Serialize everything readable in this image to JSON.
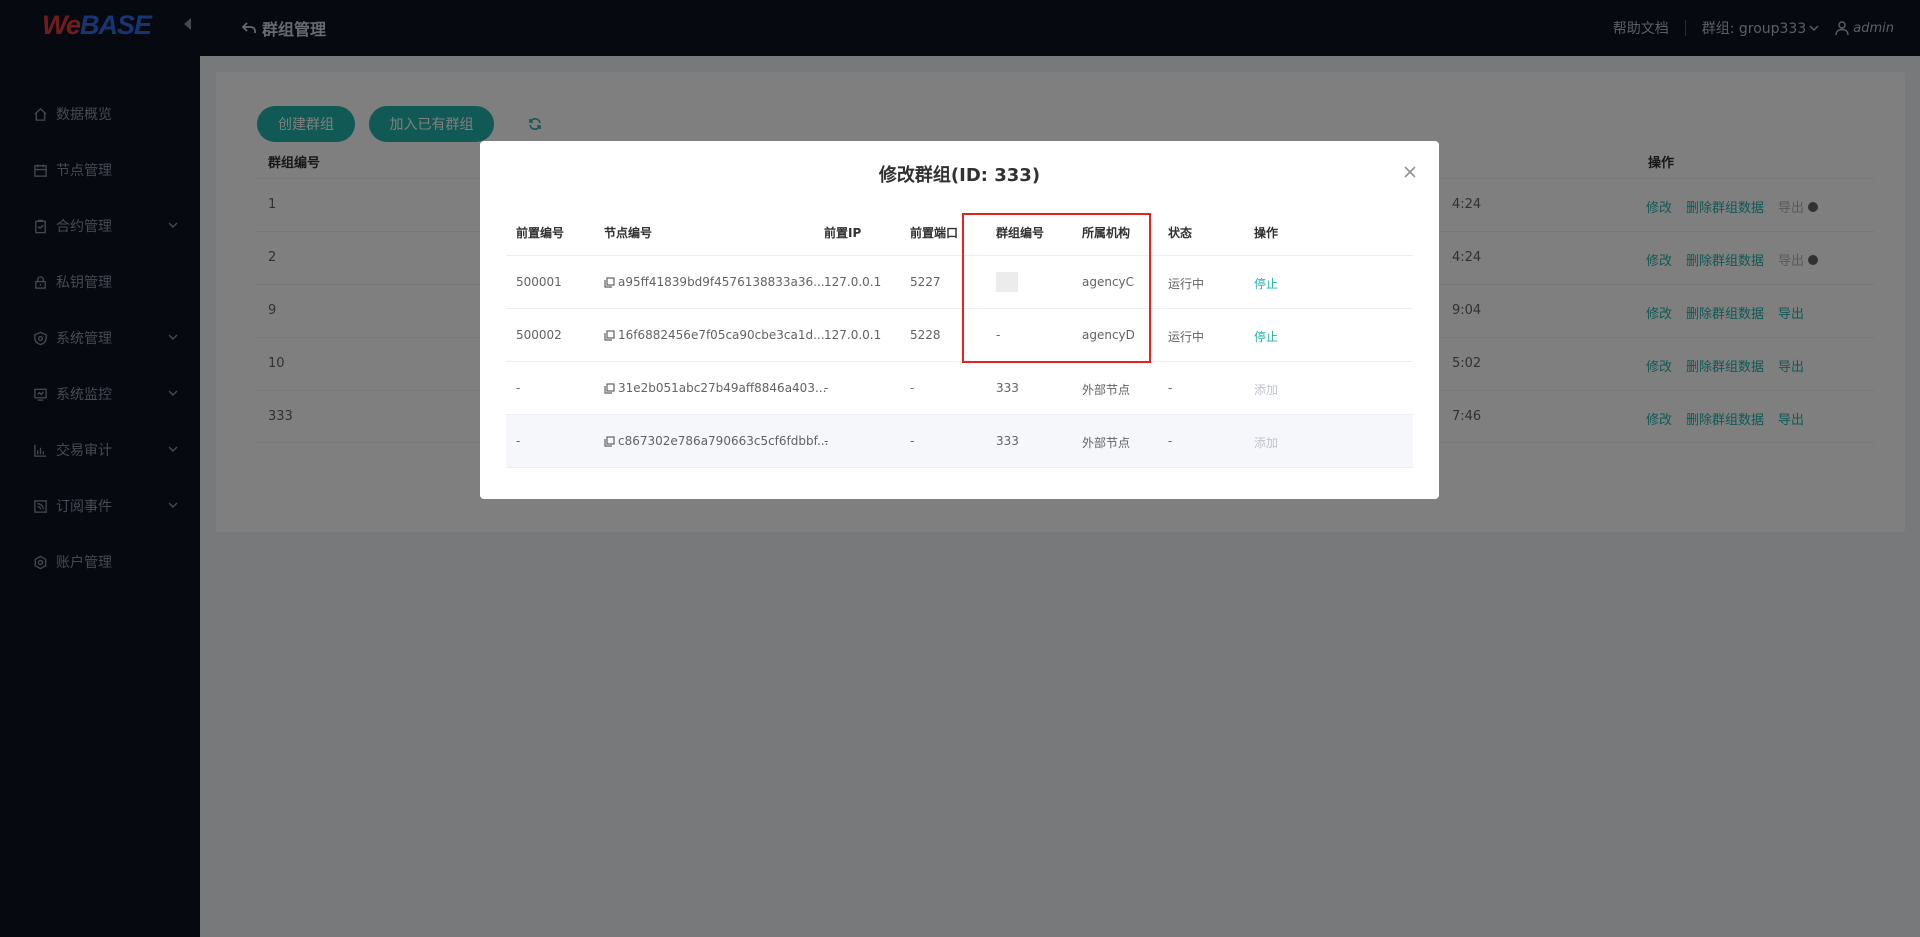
{
  "brand": {
    "we": "We",
    "base": "BASE"
  },
  "sidebar": {
    "items": [
      {
        "label": "数据概览",
        "icon": "home-icon",
        "expandable": false
      },
      {
        "label": "节点管理",
        "icon": "calendar-icon",
        "expandable": false
      },
      {
        "label": "合约管理",
        "icon": "clipboard-icon",
        "expandable": true
      },
      {
        "label": "私钥管理",
        "icon": "lock-icon",
        "expandable": false
      },
      {
        "label": "系统管理",
        "icon": "shield-icon",
        "expandable": true
      },
      {
        "label": "系统监控",
        "icon": "monitor-icon",
        "expandable": true
      },
      {
        "label": "交易审计",
        "icon": "bar-chart-icon",
        "expandable": true
      },
      {
        "label": "订阅事件",
        "icon": "rss-icon",
        "expandable": true
      },
      {
        "label": "账户管理",
        "icon": "settings-icon",
        "expandable": false
      }
    ]
  },
  "header": {
    "title": "群组管理",
    "help": "帮助文档",
    "group_selector": "群组: group333",
    "user": "admin"
  },
  "toolbar": {
    "create_group": "创建群组",
    "join_group": "加入已有群组"
  },
  "group_table": {
    "col_id": "群组编号",
    "col_ops": "操作",
    "rows": [
      {
        "id": "1",
        "time": "4:24",
        "modify": "修改",
        "delete": "删除群组数据",
        "export": "导出",
        "export_enabled": false
      },
      {
        "id": "2",
        "time": "4:24",
        "modify": "修改",
        "delete": "删除群组数据",
        "export": "导出",
        "export_enabled": false
      },
      {
        "id": "9",
        "time": "9:04",
        "modify": "修改",
        "delete": "删除群组数据",
        "export": "导出",
        "export_enabled": true
      },
      {
        "id": "10",
        "time": "5:02",
        "modify": "修改",
        "delete": "删除群组数据",
        "export": "导出",
        "export_enabled": true
      },
      {
        "id": "333",
        "time": "7:46",
        "modify": "修改",
        "delete": "删除群组数据",
        "export": "导出",
        "export_enabled": true
      }
    ]
  },
  "dialog": {
    "title": "修改群组(ID: 333)",
    "columns": [
      "前置编号",
      "节点编号",
      "前置IP",
      "前置端口",
      "群组编号",
      "所属机构",
      "状态",
      "操作"
    ],
    "rows": [
      {
        "front_id": "500001",
        "node_id": "a95ff41839bd9f4576138833a36...",
        "ip": "127.0.0.1",
        "port": "5227",
        "group": "",
        "agency": "agencyC",
        "status": "运行中",
        "action": "停止",
        "action_enabled": true
      },
      {
        "front_id": "500002",
        "node_id": "16f6882456e7f05ca90cbe3ca1d...",
        "ip": "127.0.0.1",
        "port": "5228",
        "group": "-",
        "agency": "agencyD",
        "status": "运行中",
        "action": "停止",
        "action_enabled": true
      },
      {
        "front_id": "-",
        "node_id": "31e2b051abc27b49aff8846a403...",
        "ip": "-",
        "port": "-",
        "group": "333",
        "agency": "外部节点",
        "status": "-",
        "action": "添加",
        "action_enabled": false
      },
      {
        "front_id": "-",
        "node_id": "c867302e786a790663c5cf6fdbbf...",
        "ip": "-",
        "port": "-",
        "group": "333",
        "agency": "外部节点",
        "status": "-",
        "action": "添加",
        "action_enabled": false
      }
    ]
  },
  "colors": {
    "accent": "#20b2aa",
    "sidebar_bg": "#0c1220",
    "highlight": "#e32222"
  }
}
